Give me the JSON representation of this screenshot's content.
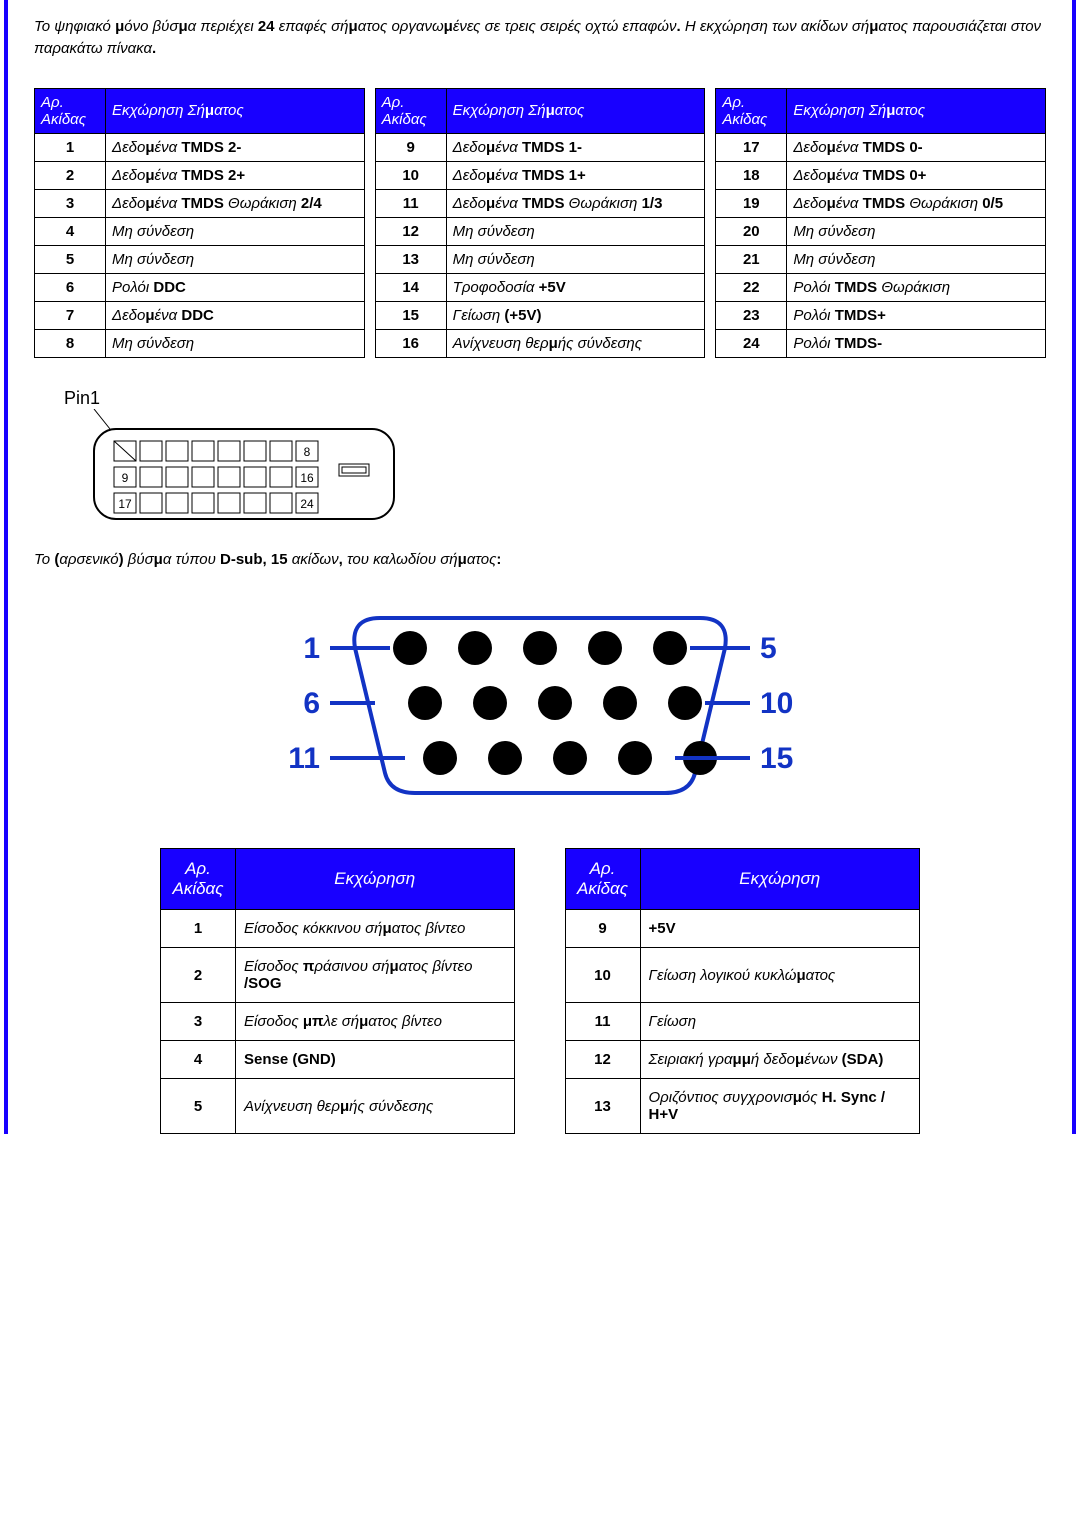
{
  "intro": {
    "p1a": "Το ψηφιακό ",
    "p1b": "μ",
    "p1c": "όνο βύσ",
    "p1d": "μ",
    "p1e": "α ",
    "p1f": "π",
    "p1g": "εριέχει ",
    "p1h": "24",
    "p1i": " ε",
    "p1j": "π",
    "p1k": "αφές σή",
    "p1l": "μ",
    "p1m": "ατος οργανω",
    "p1n": "μ",
    "p1o": "ένες σε τρεις σειρές οχτώ ε",
    "p1p": "π",
    "p1q": "αφών",
    "p1r": ".",
    "p1s": " Η εκχώρηση των ακίδων σή",
    "p1t": "μ",
    "p1u": "ατος ",
    "p1v": "π",
    "p1w": "αρουσιάζεται στον ",
    "p1x": "π",
    "p1y": "αρακάτω ",
    "p1z": "π",
    "p1aa": "ίνακα",
    "p1ab": "."
  },
  "dvi": {
    "hdr_pin": "Αρ. Ακίδας",
    "hdr_asgn_a": "Εκχώρηση ",
    "hdr_asgn_b": "Σ",
    "hdr_asgn_c": "ή",
    "hdr_asgn_d": "μ",
    "hdr_asgn_e": "ατος",
    "rows": [
      {
        "n": "1",
        "a": "Δεδο",
        "b": "μ",
        "c": "ένα ",
        "d": "TMDS 2-"
      },
      {
        "n": "2",
        "a": "Δεδο",
        "b": "μ",
        "c": "ένα ",
        "d": "TMDS 2+"
      },
      {
        "n": "3",
        "a": "Δεδο",
        "b": "μ",
        "c": "ένα ",
        "d": "TMDS",
        "e": " Θωράκιση ",
        "f": "2/4"
      },
      {
        "n": "4",
        "a": "Μη σύνδεση"
      },
      {
        "n": "5",
        "a": "Μη σύνδεση"
      },
      {
        "n": "6",
        "a": "Ρολόι ",
        "d": "DDC"
      },
      {
        "n": "7",
        "a": "Δεδο",
        "b": "μ",
        "c": "ένα ",
        "d": "DDC"
      },
      {
        "n": "8",
        "a": "Μη σύνδεση"
      },
      {
        "n": "9",
        "a": "Δεδο",
        "b": "μ",
        "c": "ένα ",
        "d": "TMDS 1-"
      },
      {
        "n": "10",
        "a": "Δεδο",
        "b": "μ",
        "c": "ένα ",
        "d": "TMDS 1+"
      },
      {
        "n": "11",
        "a": "Δεδο",
        "b": "μ",
        "c": "ένα ",
        "d": "TMDS",
        "e": " Θωράκιση ",
        "f": "1/3"
      },
      {
        "n": "12",
        "a": "Μη σύνδεση"
      },
      {
        "n": "13",
        "a": "Μη σύνδεση"
      },
      {
        "n": "14",
        "a": "Τροφοδοσία ",
        "d": "+5V"
      },
      {
        "n": "15",
        "a": "Γείωση ",
        "d": "(+5V)"
      },
      {
        "n": "16",
        "a": "Ανίχνευση θερ",
        "b": "μ",
        "c": "ής σύνδεσης"
      },
      {
        "n": "17",
        "a": "Δεδο",
        "b": "μ",
        "c": "ένα ",
        "d": "TMDS 0-"
      },
      {
        "n": "18",
        "a": "Δεδο",
        "b": "μ",
        "c": "ένα ",
        "d": "TMDS 0+"
      },
      {
        "n": "19",
        "a": "Δεδο",
        "b": "μ",
        "c": "ένα ",
        "d": "TMDS",
        "e": " Θωράκιση ",
        "f": "0/5"
      },
      {
        "n": "20",
        "a": "Μη σύνδεση"
      },
      {
        "n": "21",
        "a": "Μη σύνδεση"
      },
      {
        "n": "22",
        "a": "Ρολόι ",
        "d": "TMDS",
        "e": " Θωράκιση"
      },
      {
        "n": "23",
        "a": "Ρολόι ",
        "d": "TMDS+"
      },
      {
        "n": "24",
        "a": "Ρολόι ",
        "d": "TMDS-"
      }
    ]
  },
  "pin1label": "Pin1",
  "dvi_svg": {
    "p8": "8",
    "p9": "9",
    "p16": "16",
    "p17": "17",
    "p24": "24"
  },
  "dsub_intro": {
    "a": "Το ",
    "b": "(",
    "c": "αρσενικό",
    "d": ")",
    "e": " βύσ",
    "f": "μ",
    "g": "α τύ",
    "h": "π",
    "i": "ου ",
    "j": "D-sub, 15",
    "k": " ακίδων",
    "l": ",",
    "m": " του καλωδίου σή",
    "n": "μ",
    "o": "ατος",
    "p": ":"
  },
  "dsub_labels": {
    "l1": "1",
    "l5": "5",
    "l6": "6",
    "l10": "10",
    "l11": "11",
    "l15": "15"
  },
  "vga": {
    "hdr_pin": "Αρ. Ακίδας",
    "hdr_asgn": "Εκχώρηση",
    "left": [
      {
        "n": "1",
        "a": "Είσοδος κόκκινου σή",
        "b": "μ",
        "c": "ατος βίντεο"
      },
      {
        "n": "2",
        "a": "Είσοδος ",
        "h": "π",
        "b2": "ράσινου σή",
        "b": "μ",
        "c": "ατος βίντεο ",
        "d": "/SOG"
      },
      {
        "n": "3",
        "a": "Είσοδος ",
        "b": "μπ",
        "c": "λε σή",
        "b2": "μ",
        "c2": "ατος βίντεο"
      },
      {
        "n": "4",
        "d": "Sense (GND)"
      },
      {
        "n": "5",
        "a": "Ανίχνευση θερ",
        "b": "μ",
        "c": "ής σύνδεσης"
      }
    ],
    "right": [
      {
        "n": "9",
        "d": "+5V"
      },
      {
        "n": "10",
        "a": "Γείωση λογικού κυκλώ",
        "b": "μ",
        "c": "ατος"
      },
      {
        "n": "11",
        "a": "Γείωση"
      },
      {
        "n": "12",
        "s": "Σ",
        "a": "ειριακή γρα",
        "b": "μμ",
        "c": "ή δεδο",
        "b2": "μ",
        "c2": "ένων ",
        "d": "(SDA)"
      },
      {
        "n": "13",
        "a": "Οριζόντιος συγχρονισ",
        "b": "μ",
        "c": "ός ",
        "d": "H. Sync / H+V"
      }
    ]
  }
}
